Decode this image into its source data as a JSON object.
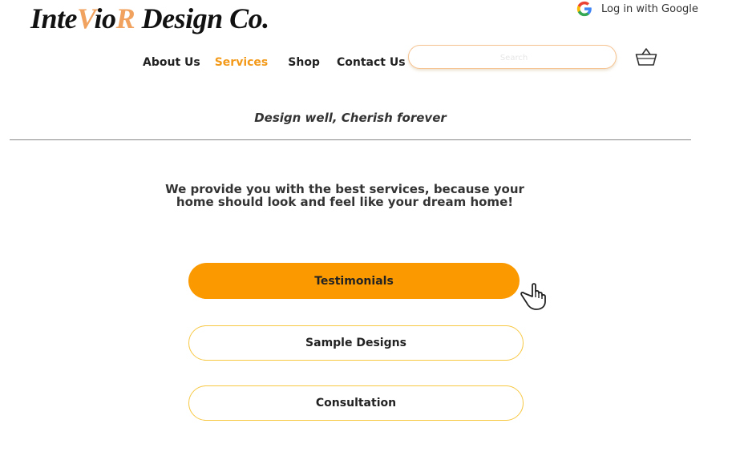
{
  "brand": {
    "part1": "Inte",
    "part2": "V",
    "part3": "io",
    "part4": "R",
    "part5": " Design Co.",
    "accent_color": "#f0a25e"
  },
  "auth": {
    "google_label": "Log in with Google",
    "icon": "google-icon"
  },
  "nav": {
    "items": [
      {
        "label": "About Us"
      },
      {
        "label": "Services"
      },
      {
        "label": "Shop"
      },
      {
        "label": "Contact Us"
      }
    ],
    "active_color": "#f39a1a"
  },
  "search": {
    "placeholder": "Search",
    "value": ""
  },
  "cart": {
    "icon": "basket-icon"
  },
  "tagline": "Design well, Cherish forever",
  "intro": {
    "line1": "We provide you with the best services, because your",
    "line2": "home should look and feel like your dream home!"
  },
  "buttons": {
    "testimonials": "Testimonials",
    "sample_designs": "Sample Designs",
    "consultation": "Consultation",
    "primary_color": "#fb9a00",
    "outline_color": "#f7c844"
  },
  "pointer": {
    "icon": "hand-pointer-icon"
  }
}
